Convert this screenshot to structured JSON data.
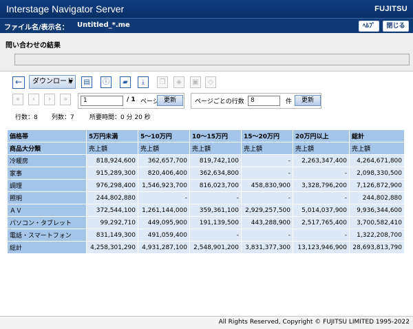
{
  "app": {
    "title": "Interstage Navigator Server",
    "brand": "FUJITSU"
  },
  "filebar": {
    "label": "ファイル名/表示名：",
    "filename": "Untitled_*.me",
    "help": "ﾍﾙﾌﾟ",
    "close": "閉じる"
  },
  "subheader": {
    "title": "問い合わせの結果"
  },
  "toolbar": {
    "download": "ダウンロード"
  },
  "pagination": {
    "current_page": "1",
    "total": "/ 1",
    "page_unit": "ページ",
    "update": "更新",
    "rows_label": "ページごとの行数",
    "rows_value": "8",
    "rows_unit": "件",
    "rows_update": "更新"
  },
  "stats": {
    "rows": "行数：8",
    "cols": "列数：7",
    "time": "所要時間：0 分  20 秒"
  },
  "table": {
    "header1": [
      "価格帯",
      "5万円未満",
      "5～10万円",
      "10～15万円",
      "15～20万円",
      "20万円以上",
      "総計"
    ],
    "header2": [
      "商品大分類",
      "売上額",
      "売上額",
      "売上額",
      "売上額",
      "売上額",
      "売上額"
    ],
    "rows": [
      [
        "冷暖房",
        "818,924,600",
        "362,657,700",
        "819,742,100",
        "-",
        "2,263,347,400",
        "4,264,671,800"
      ],
      [
        "家事",
        "915,289,300",
        "820,406,400",
        "362,634,800",
        "-",
        "-",
        "2,098,330,500"
      ],
      [
        "調理",
        "976,298,400",
        "1,546,923,700",
        "816,023,700",
        "458,830,900",
        "3,328,796,200",
        "7,126,872,900"
      ],
      [
        "照明",
        "244,802,880",
        "-",
        "-",
        "-",
        "-",
        "244,802,880"
      ],
      [
        "ＡＶ",
        "372,544,100",
        "1,261,144,000",
        "359,361,100",
        "2,929,257,500",
        "5,014,037,900",
        "9,936,344,600"
      ],
      [
        "パソコン・タブレット",
        "99,292,710",
        "449,095,900",
        "191,139,500",
        "443,288,900",
        "2,517,765,400",
        "3,700,582,410"
      ],
      [
        "電話・スマートフォン",
        "831,149,300",
        "491,059,400",
        "-",
        "-",
        "-",
        "1,322,208,700"
      ],
      [
        "総計",
        "4,258,301,290",
        "4,931,287,100",
        "2,548,901,200",
        "3,831,377,300",
        "13,123,946,900",
        "28,693,813,790"
      ]
    ]
  },
  "footer": {
    "copyright": "All Rights Reserved, Copyright © FUJITSU LIMITED 1995-2022"
  }
}
